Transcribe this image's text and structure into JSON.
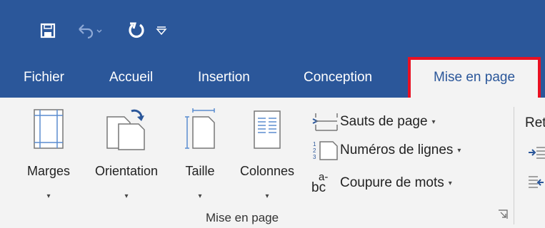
{
  "quick_access": {
    "items": [
      {
        "icon": "save-icon"
      },
      {
        "icon": "undo-icon"
      },
      {
        "icon": "redo-icon"
      },
      {
        "icon": "customize-dropdown-icon"
      }
    ]
  },
  "tabs": [
    {
      "label": "Fichier"
    },
    {
      "label": "Accueil"
    },
    {
      "label": "Insertion"
    },
    {
      "label": "Conception"
    },
    {
      "label": "Mise en page",
      "active": true
    }
  ],
  "ribbon": {
    "group_label": "Mise en page",
    "large_buttons": [
      {
        "label": "Marges",
        "icon": "margins-icon"
      },
      {
        "label": "Orientation",
        "icon": "orientation-icon"
      },
      {
        "label": "Taille",
        "icon": "size-icon"
      },
      {
        "label": "Colonnes",
        "icon": "columns-icon"
      }
    ],
    "small_buttons": [
      {
        "label": "Sauts de page",
        "icon": "page-break-icon"
      },
      {
        "label": "Numéros de lignes",
        "icon": "line-numbers-icon"
      },
      {
        "label": "Coupure de mots",
        "icon": "hyphenation-icon"
      }
    ],
    "hyphen_glyph_top": "a-",
    "hyphen_glyph_bottom": "bc",
    "next_group_partial": "Ret",
    "dropdown_glyph": "▾"
  },
  "colors": {
    "title_bar": "#2b579a",
    "ribbon_bg": "#f3f3f3",
    "highlight": "#e81123"
  }
}
